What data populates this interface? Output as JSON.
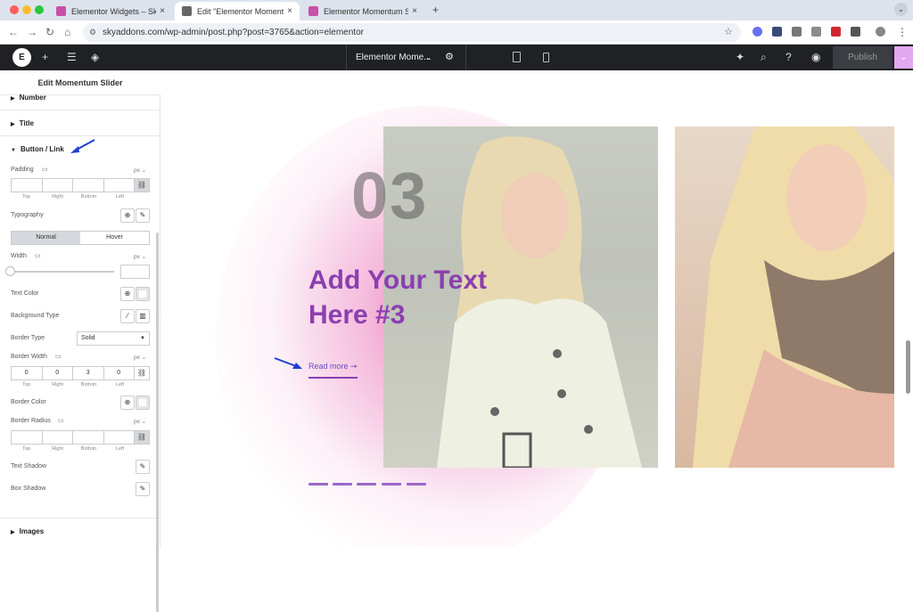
{
  "browser": {
    "tabs": [
      {
        "label": "Elementor Widgets – Sky Addo",
        "active": false
      },
      {
        "label": "Edit \"Elementor Momentum S",
        "active": true
      },
      {
        "label": "Elementor Momentum Slider",
        "active": false
      }
    ],
    "new_tab": "+",
    "url": "skyaddons.com/wp-admin/post.php?post=3765&action=elementor"
  },
  "editor": {
    "logo": "E",
    "doc_name": "Elementor Mome...",
    "publish": "Publish"
  },
  "panel": {
    "title": "Edit Momentum Slider",
    "sections": {
      "number": "Number",
      "title": "Title",
      "button_link": "Button / Link",
      "images": "Images"
    },
    "padding": {
      "label": "Padding",
      "unit": "px",
      "values": [
        "",
        "",
        "",
        ""
      ],
      "sublabels": [
        "Top",
        "Right",
        "Bottom",
        "Left"
      ]
    },
    "typography": "Typography",
    "state_tabs": [
      "Normal",
      "Hover"
    ],
    "width": {
      "label": "Width",
      "unit": "px",
      "value": ""
    },
    "text_color": "Text Color",
    "background_type": "Background Type",
    "border_type": {
      "label": "Border Type",
      "value": "Solid"
    },
    "border_width": {
      "label": "Border Width",
      "unit": "px",
      "values": [
        "0",
        "0",
        "3",
        "0"
      ],
      "sublabels": [
        "Top",
        "Right",
        "Bottom",
        "Left"
      ]
    },
    "border_color": "Border Color",
    "border_radius": {
      "label": "Border Radius",
      "unit": "px",
      "values": [
        "",
        "",
        "",
        ""
      ],
      "sublabels": [
        "Top",
        "Right",
        "Bottom",
        "Left"
      ]
    },
    "text_shadow": "Text Shadow",
    "box_shadow": "Box Shadow"
  },
  "slide": {
    "number": "03",
    "heading": "Add Your Text Here #3",
    "read_more": "Read more ➞"
  },
  "colors": {
    "accent": "#8b3fb0",
    "link": "#6a48c9",
    "toolbar": "#1f2124"
  }
}
